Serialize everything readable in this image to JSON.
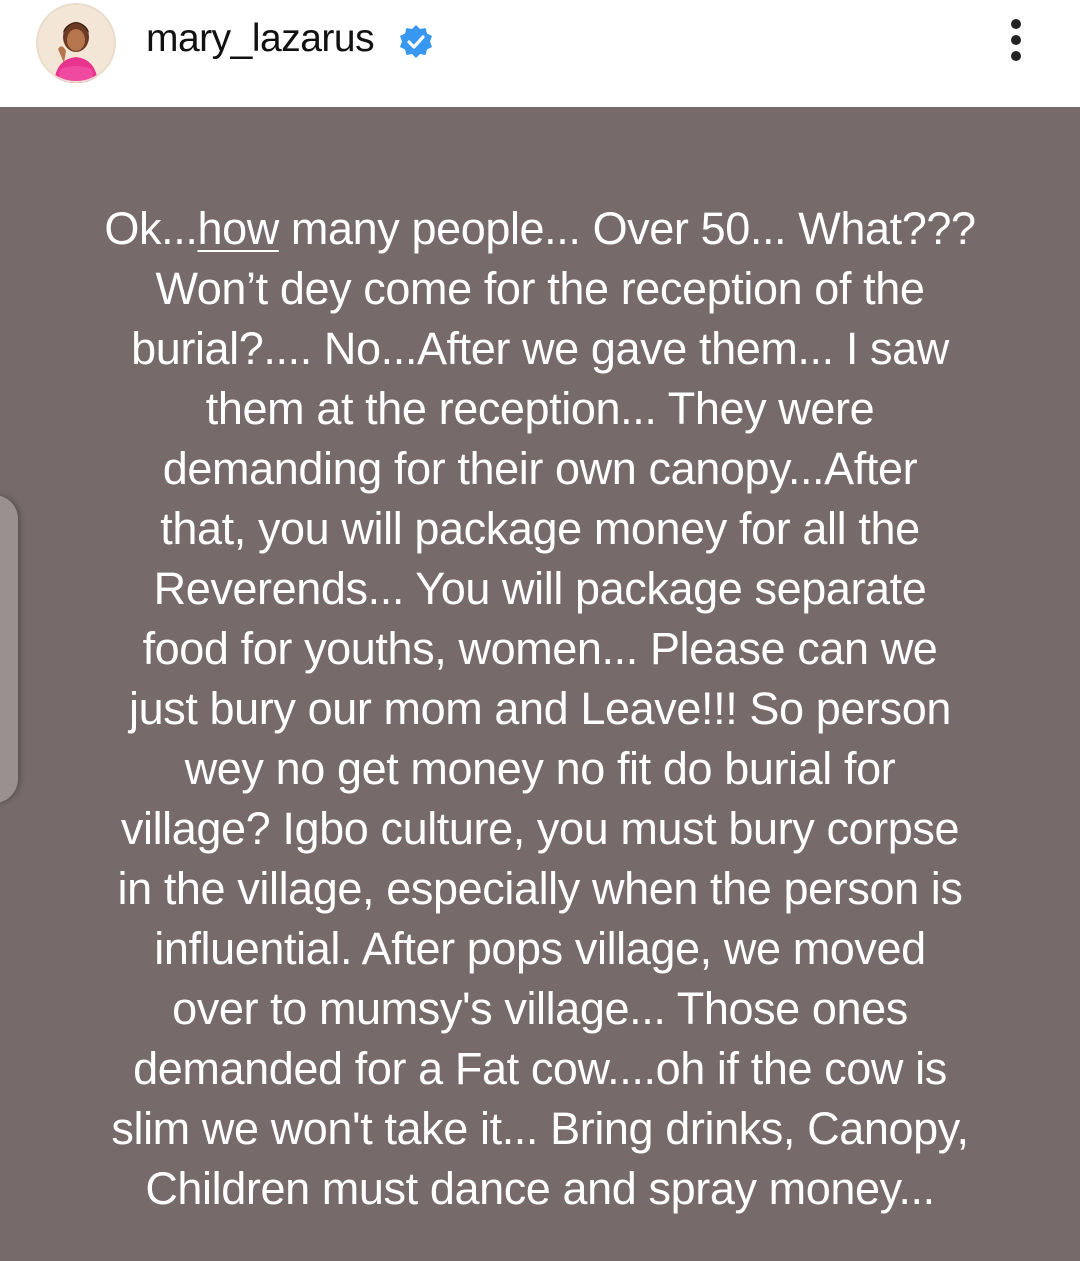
{
  "header": {
    "username": "mary_lazarus",
    "verified": true,
    "avatar_icon": "profile-photo",
    "more_icon": "vertical-dots-icon"
  },
  "post": {
    "background_color": "#766a6a",
    "text_color": "#ffffff",
    "lines": [
      {
        "pre": "Ok...",
        "link": "how",
        "post": " many people... Over 50... What???"
      },
      "Won’t dey come for the reception of the",
      "burial?.... No...After we gave them... I saw",
      "them at the reception... They were",
      "demanding for their own canopy...After",
      "that, you will package money for all the",
      "Reverends... You will package separate",
      "food for youths, women... Please can we",
      "just bury our mom and Leave!!! So person",
      "wey no get money no fit do burial for",
      "village? Igbo culture, you must bury corpse",
      "in the village, especially when the person is",
      "influential. After pops village, we moved",
      "over to mumsy's village... Those ones",
      "demanded for a Fat cow....oh if the cow is",
      "slim we won't take it... Bring drinks, Canopy,",
      "Children must dance and spray money..."
    ]
  }
}
